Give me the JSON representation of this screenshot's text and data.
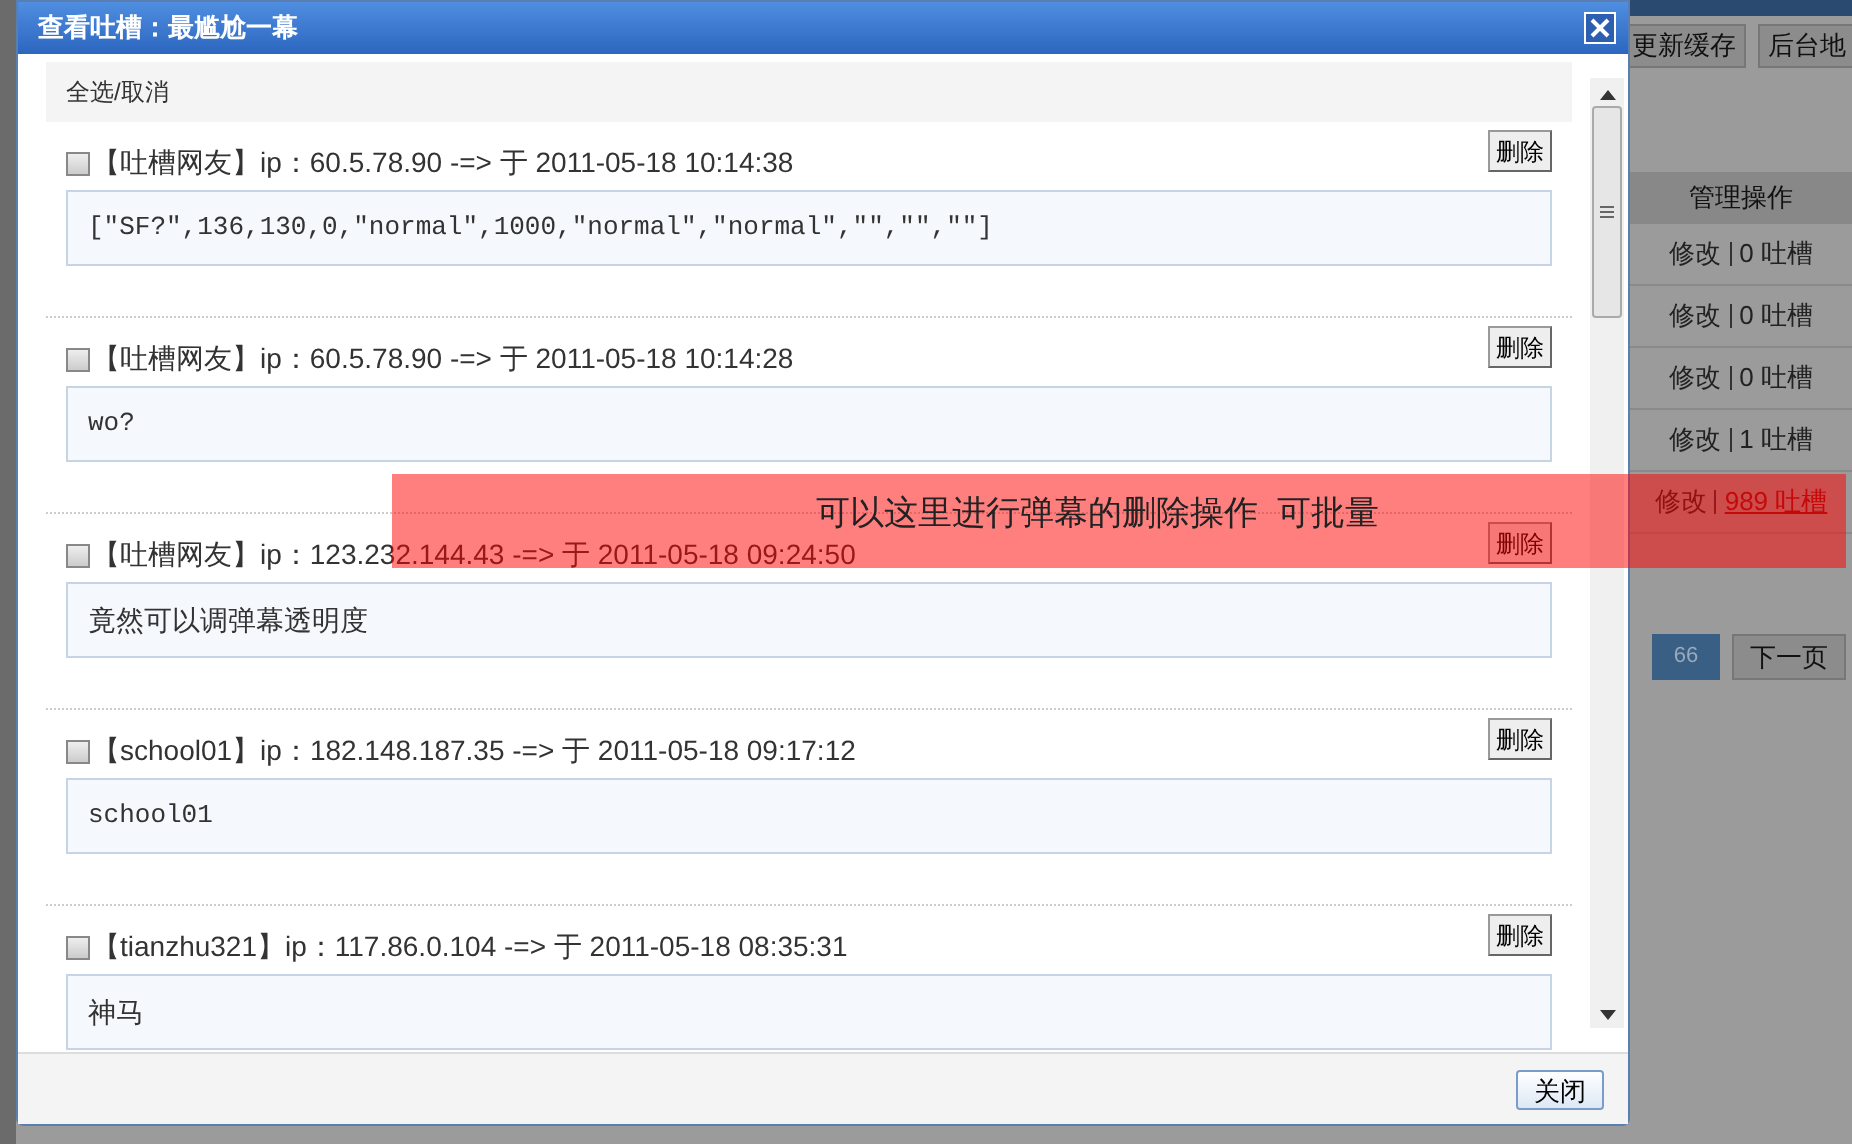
{
  "background": {
    "toolbar_buttons": [
      "更新缓存",
      "后台地"
    ],
    "table": {
      "header": "管理操作",
      "rows": [
        {
          "edit": "修改",
          "count": "0 吐槽",
          "link": false
        },
        {
          "edit": "修改",
          "count": "0 吐槽",
          "link": false
        },
        {
          "edit": "修改",
          "count": "0 吐槽",
          "link": false
        },
        {
          "edit": "修改",
          "count": "1 吐槽",
          "link": false
        },
        {
          "edit": "修改",
          "count": "989 吐槽",
          "link": true
        }
      ]
    },
    "pagination": {
      "pages": [
        {
          "label": "66",
          "selected": true
        }
      ],
      "next": "下一页"
    }
  },
  "dialog": {
    "title": "查看吐槽：最尴尬一幕",
    "select_all": "全选/取消",
    "comments": [
      {
        "header": "【吐槽网友】ip：60.5.78.90 -=> 于 2011-05-18 10:14:38",
        "checked": false,
        "delete": "删除",
        "content": "[\"SF?\",136,130,0,\"normal\",1000,\"normal\",\"normal\",\"\",\"\",\"\"]",
        "kind": "code"
      },
      {
        "header": "【吐槽网友】ip：60.5.78.90 -=> 于 2011-05-18 10:14:28",
        "checked": false,
        "delete": "删除",
        "content": "wo?",
        "kind": "code"
      },
      {
        "header": "【吐槽网友】ip：123.232.144.43 -=> 于 2011-05-18 09:24:50",
        "checked": false,
        "delete": "删除",
        "content": "竟然可以调弹幕透明度",
        "kind": "text"
      },
      {
        "header": "【school01】ip：182.148.187.35 -=> 于 2011-05-18 09:17:12",
        "checked": false,
        "delete": "删除",
        "content": "school01",
        "kind": "code"
      },
      {
        "header": "【tianzhu321】ip：117.86.0.104 -=> 于 2011-05-18 08:35:31",
        "checked": false,
        "delete": "删除",
        "content": "神马",
        "kind": "text"
      }
    ],
    "close": "关闭"
  },
  "annotation": {
    "text": "可以这里进行弹幕的删除操作  可批量"
  }
}
